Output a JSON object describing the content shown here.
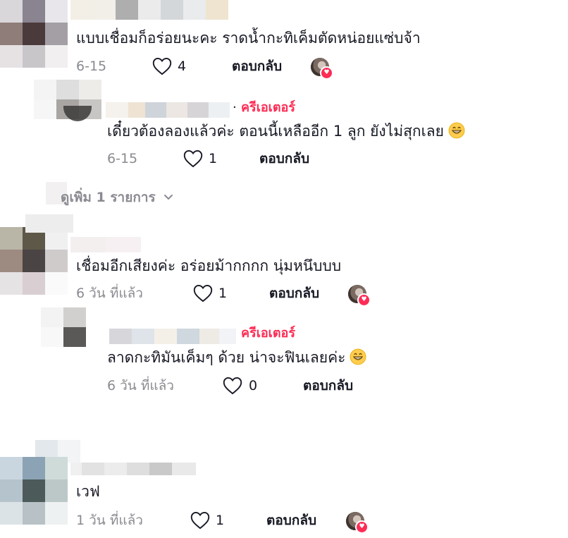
{
  "comments": [
    {
      "text": "แบบเชื่อมก็อร่อยนะคะ ราดน้ำกะทิเค็มตัดหน่อยแซ่บจ้า",
      "time": "6-15",
      "likes": "4",
      "reply_label": "ตอบกลับ",
      "liked_by_creator": true,
      "reply": {
        "creator_label": "ครีเอเตอร์",
        "separator": "·",
        "text": "เดี๋ยวต้องลองแล้วค่ะ ตอนนี้เหลืออีก 1 ลูก ยังไม่สุกเลย",
        "emoji": "grinning-face",
        "time": "6-15",
        "likes": "1",
        "reply_label": "ตอบกลับ"
      },
      "view_more_label": "ดูเพิ่ม 1 รายการ"
    },
    {
      "text": "เชื่อมอีกเสียงค่ะ อร่อยม้ากกกก นุ่มหนึบบบ",
      "time": "6 วัน ที่แล้ว",
      "likes": "1",
      "reply_label": "ตอบกลับ",
      "liked_by_creator": true,
      "reply": {
        "creator_label": "ครีเอเตอร์",
        "text": "ลาดกะทิมันเค็มๆ ด้วย น่าจะฟินเลยค่ะ",
        "emoji": "grinning-face",
        "time": "6 วัน ที่แล้ว",
        "likes": "0",
        "reply_label": "ตอบกลับ"
      }
    },
    {
      "text": "เวฟ",
      "time": "1 วัน ที่แล้ว",
      "likes": "1",
      "reply_label": "ตอบกลับ",
      "liked_by_creator": true
    }
  ],
  "colors": {
    "creator_accent": "#fe2c55",
    "muted_text": "#8a8b91",
    "primary_text": "#161823"
  },
  "icons": {
    "like": "heart-outline-icon",
    "expand": "chevron-down-icon",
    "creator_like_badge": "heart-badge-icon"
  }
}
